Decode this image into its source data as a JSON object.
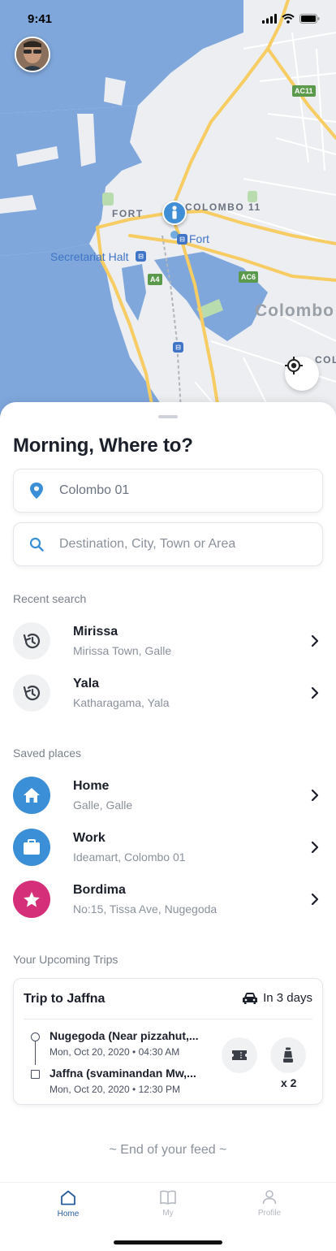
{
  "status_bar": {
    "time": "9:41"
  },
  "map": {
    "labels": {
      "fort": "FORT",
      "colombo_11": "COLOMBO 11",
      "fort_station": "Fort",
      "secretariat_halt": "Secretariat Halt",
      "colombo": "Colombo",
      "col": "COL",
      "road_ac11": "AC11",
      "road_a4": "A4",
      "road_ac6": "AC6"
    },
    "colors": {
      "water": "#7fa7db",
      "land": "#eceef1",
      "road": "#f6cc63",
      "park": "#b9dcae"
    }
  },
  "sheet": {
    "greeting": "Morning, Where to?",
    "origin": {
      "value": "Colombo 01",
      "icon": "location-pin-icon"
    },
    "destination": {
      "placeholder": "Destination, City, Town or Area",
      "icon": "search-icon"
    },
    "recent_search": {
      "title": "Recent search",
      "items": [
        {
          "title": "Mirissa",
          "subtitle": "Mirissa Town, Galle",
          "icon": "history-icon"
        },
        {
          "title": "Yala",
          "subtitle": "Katharagama, Yala",
          "icon": "history-icon"
        }
      ]
    },
    "saved_places": {
      "title": "Saved places",
      "items": [
        {
          "title": "Home",
          "subtitle": "Galle, Galle",
          "icon": "home-icon",
          "color": "#3a8fd6"
        },
        {
          "title": "Work",
          "subtitle": "Ideamart, Colombo 01",
          "icon": "briefcase-icon",
          "color": "#3a8fd6"
        },
        {
          "title": "Bordima",
          "subtitle": "No:15, Tissa Ave, Nugegoda",
          "icon": "star-icon",
          "color": "#d62f7a"
        }
      ]
    },
    "upcoming": {
      "title": "Your Upcoming Trips",
      "trip": {
        "name": "Trip to Jaffna",
        "when": "In 3 days",
        "from": {
          "name": "Nugegoda (Near pizzahut,...",
          "datetime": "Mon, Oct 20, 2020 • 04:30 AM"
        },
        "to": {
          "name": "Jaffna (svaminandan Mw,...",
          "datetime": "Mon, Oct 20, 2020 • 12:30 PM"
        },
        "seats": "x 2"
      }
    },
    "feed_end": "~ End of your feed ~"
  },
  "nav": {
    "items": [
      {
        "label": "Home",
        "icon": "home-outline-icon",
        "active": true
      },
      {
        "label": "My",
        "icon": "map-book-icon",
        "active": false
      },
      {
        "label": "Profile",
        "icon": "person-icon",
        "active": false
      }
    ],
    "active_color": "#2a5d9f",
    "inactive_color": "#b5bac2"
  }
}
